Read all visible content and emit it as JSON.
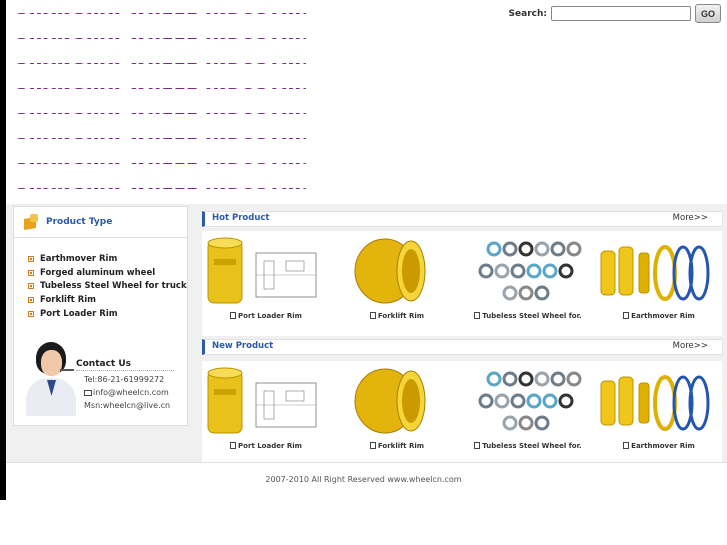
{
  "search": {
    "label": "Search:",
    "value": "",
    "button": "GO"
  },
  "logo": {
    "text": "SHANGHAI WHEEL INDUSTRIES CO. LTD",
    "rows": 8
  },
  "sidebar": {
    "title": "Product Type",
    "categories": [
      "Earthmover Rim",
      "Forged aluminum wheel",
      "Tubeless Steel Wheel for truck",
      "Forklift Rim",
      "Port Loader Rim"
    ]
  },
  "contact": {
    "title": "Contact Us",
    "tel": "Tel:86-21-61999272",
    "email": "info@wheelcn.com",
    "msn": "Msn:wheelcn@live.cn"
  },
  "hot": {
    "title": "Hot Product",
    "more": "More>>",
    "items": [
      "Port Loader Rim",
      "Forklift Rim",
      "Tubeless Steel Wheel for.",
      "Earthmover Rim"
    ]
  },
  "new": {
    "title": "New Product",
    "more": "More>>",
    "items": [
      "Port Loader Rim",
      "Forklift Rim",
      "Tubeless Steel Wheel for.",
      "Earthmover Rim"
    ]
  },
  "footer": {
    "text": "2007-2010 All Right Reserved www.wheelcn.com"
  },
  "colors": {
    "accent": "#2b5aa8",
    "logo": "#7a2a8a",
    "rim": "#f0c419",
    "bullet": "#d57a1e"
  }
}
